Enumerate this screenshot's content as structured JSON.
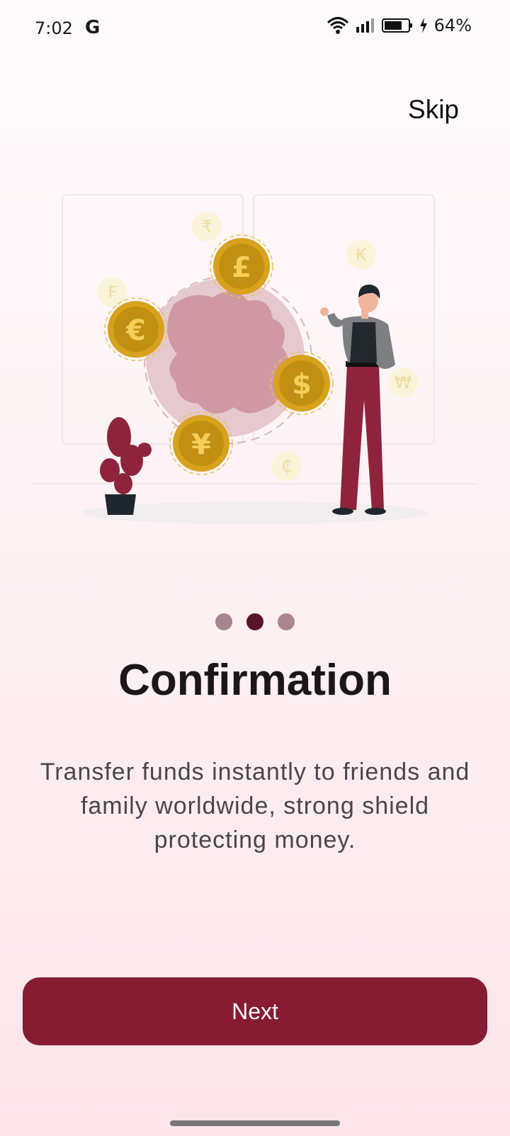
{
  "status_bar": {
    "time": "7:02",
    "g_icon": "G",
    "battery_percent": "64%"
  },
  "header": {
    "skip_label": "Skip"
  },
  "onboarding": {
    "current_page": 2,
    "page_count": 3,
    "title": "Confirmation",
    "description": "Transfer funds instantly to friends and family worldwide, strong shield protecting money."
  },
  "illustration": {
    "coins": [
      {
        "symbol": "£"
      },
      {
        "symbol": "€"
      },
      {
        "symbol": "$"
      },
      {
        "symbol": "¥"
      }
    ],
    "faint_symbols": [
      "₹",
      "₭",
      "₣",
      "₩",
      "₵"
    ]
  },
  "actions": {
    "next_label": "Next"
  },
  "colors": {
    "primary": "#861b32",
    "dot_active": "#5a1428",
    "dot_inactive": "#a9858e",
    "coin": "#d8a21c",
    "globe": "#d7a3ad"
  }
}
